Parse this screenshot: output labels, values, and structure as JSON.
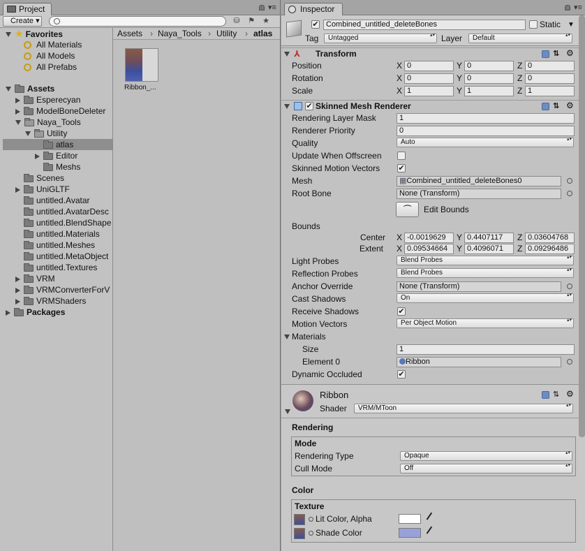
{
  "project": {
    "tab_label": "Project",
    "create_label": "Create",
    "search_placeholder": "",
    "favorites": {
      "title": "Favorites",
      "items": [
        "All Materials",
        "All Models",
        "All Prefabs"
      ]
    },
    "assets": {
      "title": "Assets",
      "items": [
        "Esperecyan",
        "ModelBoneDeleter",
        "Naya_Tools",
        "Utility",
        "atlas",
        "Editor",
        "Meshs",
        "Scenes",
        "UniGLTF",
        "untitled.Avatar",
        "untitled.AvatarDesc",
        "untitled.BlendShape",
        "untitled.Materials",
        "untitled.Meshes",
        "untitled.MetaObject",
        "untitled.Textures",
        "VRM",
        "VRMConverterForV",
        "VRMShaders"
      ]
    },
    "packages": "Packages",
    "breadcrumb": [
      "Assets",
      "Naya_Tools",
      "Utility",
      "atlas"
    ],
    "asset_label": "Ribbon_..."
  },
  "inspector": {
    "tab_label": "Inspector",
    "object_name": "Combined_untitled_deleteBones",
    "static_label": "Static",
    "tag_label": "Tag",
    "tag_value": "Untagged",
    "layer_label": "Layer",
    "layer_value": "Default",
    "transform": {
      "title": "Transform",
      "rows": [
        {
          "label": "Position",
          "x": "0",
          "y": "0",
          "z": "0"
        },
        {
          "label": "Rotation",
          "x": "0",
          "y": "0",
          "z": "0"
        },
        {
          "label": "Scale",
          "x": "1",
          "y": "1",
          "z": "1"
        }
      ]
    },
    "smr": {
      "title": "Skinned Mesh Renderer",
      "rendering_layer_mask_label": "Rendering Layer Mask",
      "rendering_layer_mask": "1",
      "renderer_priority_label": "Renderer Priority",
      "renderer_priority": "0",
      "quality_label": "Quality",
      "quality": "Auto",
      "update_offscreen_label": "Update When Offscreen",
      "skinned_motion_label": "Skinned Motion Vectors",
      "mesh_label": "Mesh",
      "mesh": "Combined_untitled_deleteBones0",
      "root_bone_label": "Root Bone",
      "root_bone": "None (Transform)",
      "edit_bounds_label": "Edit Bounds",
      "bounds_label": "Bounds",
      "center_label": "Center",
      "center": {
        "x": "-0.0019629",
        "y": "0.4407117",
        "z": "0.03604768"
      },
      "extent_label": "Extent",
      "extent": {
        "x": "0.09534664",
        "y": "0.4096071",
        "z": "0.09296486"
      },
      "light_probes_label": "Light Probes",
      "light_probes": "Blend Probes",
      "reflection_probes_label": "Reflection Probes",
      "reflection_probes": "Blend Probes",
      "anchor_override_label": "Anchor Override",
      "anchor_override": "None (Transform)",
      "cast_shadows_label": "Cast Shadows",
      "cast_shadows": "On",
      "receive_shadows_label": "Receive Shadows",
      "motion_vectors_label": "Motion Vectors",
      "motion_vectors": "Per Object Motion",
      "materials_label": "Materials",
      "size_label": "Size",
      "size": "1",
      "element0_label": "Element 0",
      "element0": "Ribbon",
      "dynamic_occluded_label": "Dynamic Occluded"
    },
    "material": {
      "name": "Ribbon",
      "shader_label": "Shader",
      "shader": "VRM/MToon",
      "rendering_title": "Rendering",
      "mode_title": "Mode",
      "rendering_type_label": "Rendering Type",
      "rendering_type": "Opaque",
      "cull_mode_label": "Cull Mode",
      "cull_mode": "Off",
      "color_title": "Color",
      "texture_title": "Texture",
      "lit_color_label": "Lit Color, Alpha",
      "shade_color_label": "Shade Color",
      "lit_color": "#ffffff",
      "shade_color": "#9aa0d8"
    }
  }
}
